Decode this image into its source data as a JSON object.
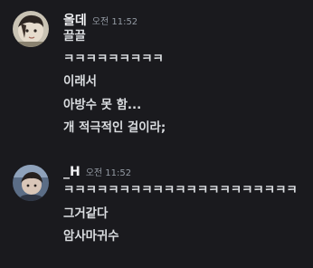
{
  "messages": [
    {
      "username": "올데",
      "timestamp": "오전 11:52",
      "lines": [
        "끌끌",
        "ㅋㅋㅋㅋㅋㅋㅋㅋㅋ",
        "이래서",
        "아방수 못 함...",
        "개 적극적인 걸이라;"
      ]
    },
    {
      "username": "_H",
      "timestamp": "오전 11:52",
      "lines": [
        "ㅋㅋㅋㅋㅋㅋㅋㅋㅋㅋㅋㅋㅋㅋㅋㅋㅋㅋㅋㅋㅋ",
        "그거같다",
        "암사마귀수"
      ]
    }
  ],
  "colors": {
    "background": "#1a1a1e",
    "username": "#f2f3f5",
    "text": "#dbdee1",
    "timestamp": "#949ba4"
  },
  "icons": [
    "avatar-olde",
    "avatar-h"
  ]
}
